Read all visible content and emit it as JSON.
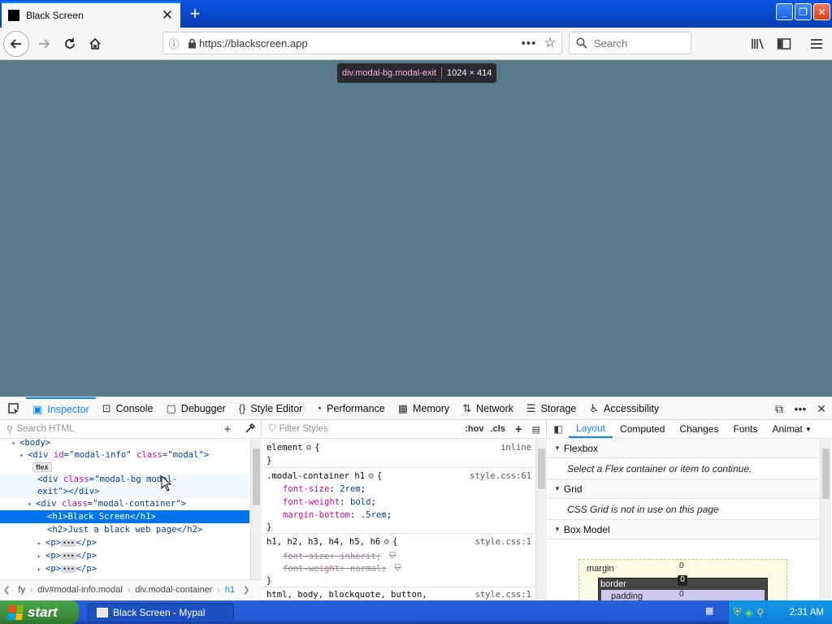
{
  "browser": {
    "tab_title": "Black Screen",
    "url": "https://blackscreen.app",
    "search_placeholder": "Search",
    "new_tab_symbol": "+",
    "url_more": "•••"
  },
  "highlighter": {
    "selector": "div.modal-bg.modal-exit",
    "dims": "1024 × 414"
  },
  "devtools": {
    "tabs": [
      {
        "icon": "inspector-icon",
        "label": "Inspector"
      },
      {
        "icon": "console-icon",
        "label": "Console"
      },
      {
        "icon": "debugger-icon",
        "label": "Debugger"
      },
      {
        "icon": "style-editor-icon",
        "label": "Style Editor"
      },
      {
        "icon": "performance-icon",
        "label": "Performance"
      },
      {
        "icon": "memory-icon",
        "label": "Memory"
      },
      {
        "icon": "network-icon",
        "label": "Network"
      },
      {
        "icon": "storage-icon",
        "label": "Storage"
      },
      {
        "icon": "accessibility-icon",
        "label": "Accessibility"
      }
    ],
    "markup": {
      "search_placeholder": "Search HTML",
      "flex_badge": "flex",
      "lines": {
        "body": "<body>",
        "div_open": "<div",
        "id_attr": "id",
        "id_val": "\"modal-info\"",
        "class_attr": "class",
        "class_val_modal": "\"modal\"",
        "close_gt": ">",
        "modal_bg_val": "\"modal-bg modal-",
        "modal_bg_val2": "exit\"",
        "div_close": "></div>",
        "modal_container_val": "\"modal-container\"",
        "h1_line": "<h1>Black Screen</h1>",
        "h2_line": "<h2>Just a black web page</h2>",
        "p_open": "<p>",
        "p_close": "</p>"
      }
    },
    "breadcrumbs": [
      "fy",
      "div#modal-info.modal",
      "div.modal-container",
      "h1"
    ],
    "rules": {
      "filter_placeholder": "Filter Styles",
      "hov": ":hov",
      "cls": ".cls",
      "element": "element",
      "inline": "inline",
      "rule1_selector": ".modal-container h1",
      "rule1_source": "style.css:61",
      "rule1_props": [
        {
          "name": "font-size",
          "value": "2rem"
        },
        {
          "name": "font-weight",
          "value": "bold"
        },
        {
          "name": "margin-bottom",
          "value": ".5rem"
        }
      ],
      "rule2_selector": "h1, h2, h3, h4, h5, h6",
      "rule2_source": "style.css:1",
      "rule2_props": [
        {
          "name": "font-size",
          "value": "inherit"
        },
        {
          "name": "font-weight",
          "value": "normal"
        }
      ],
      "rule3_selector": "html, body, blockquote, button,",
      "rule3_source": "style.css:1"
    },
    "layout": {
      "tabs": [
        "Layout",
        "Computed",
        "Changes",
        "Fonts",
        "Animat"
      ],
      "flexbox_title": "Flexbox",
      "flexbox_msg": "Select a Flex container or item to continue.",
      "grid_title": "Grid",
      "grid_msg": "CSS Grid is not in use on this page",
      "boxmodel_title": "Box Model",
      "margin_label": "margin",
      "border_label": "border",
      "padding_label": "padding",
      "zero": "0"
    }
  },
  "taskbar": {
    "start_label": "start",
    "task_label": "Black Screen - Mypal",
    "clock": "2:31 AM"
  },
  "colors": {
    "content_bg": "#57798a",
    "accent": "#0a84ff",
    "selection": "#0074e8"
  }
}
